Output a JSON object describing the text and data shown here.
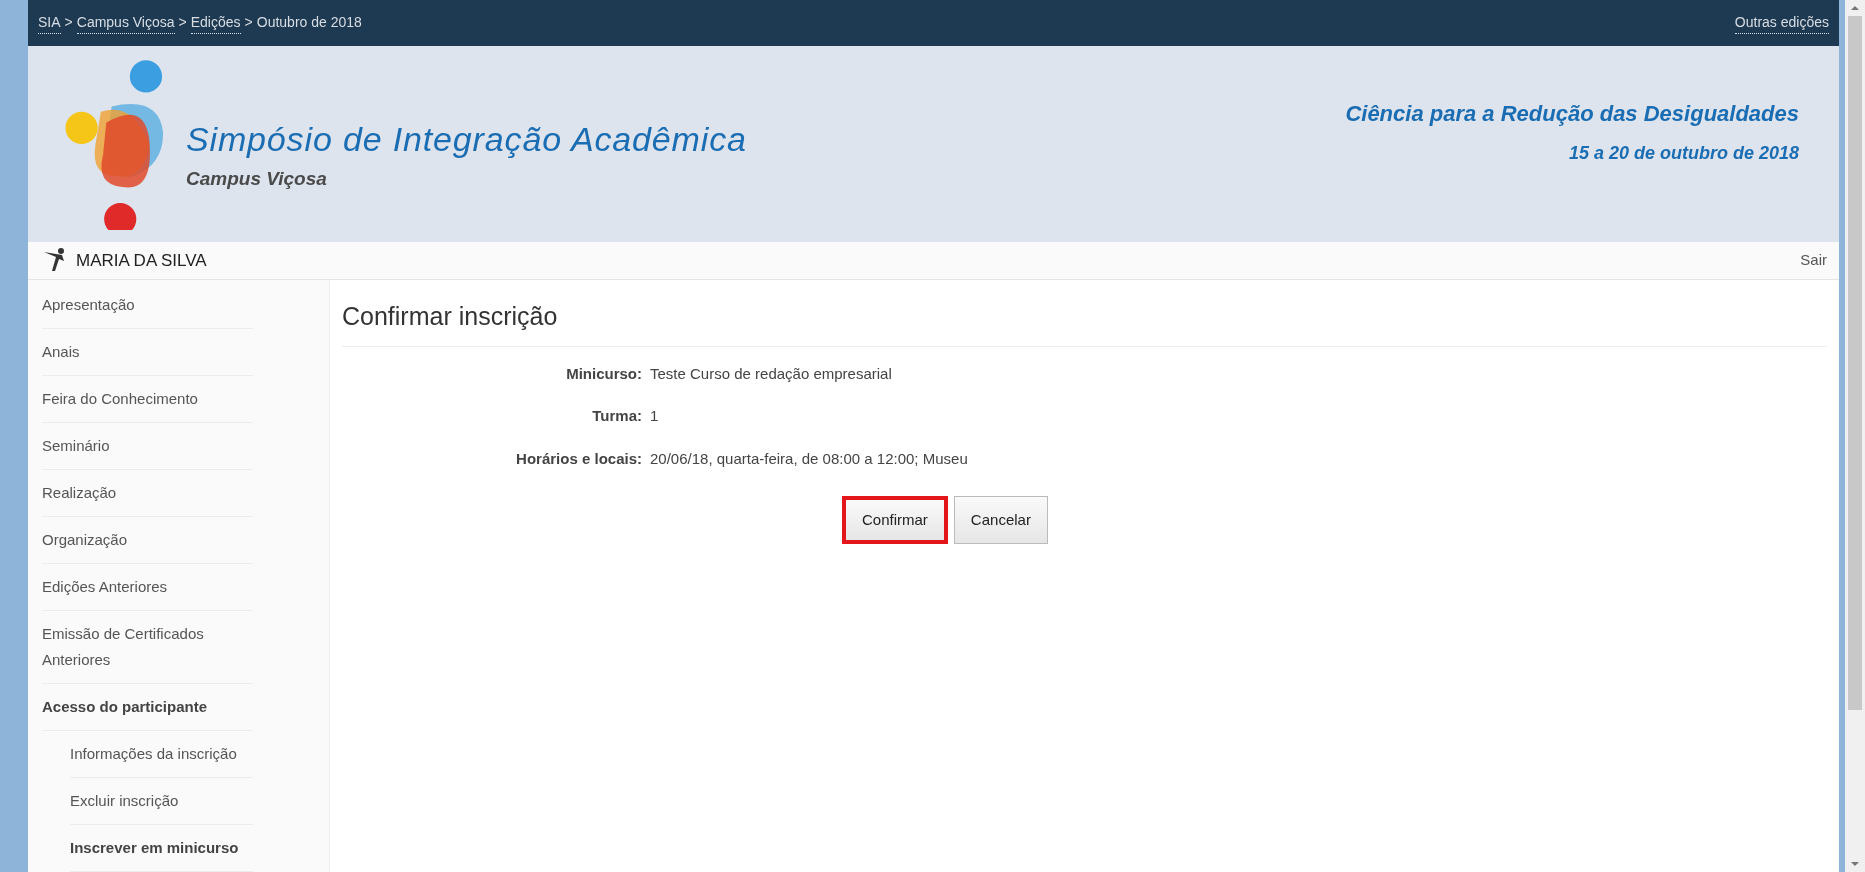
{
  "breadcrumb": [
    {
      "label": "SIA",
      "link": true
    },
    {
      "label": ">",
      "link": false
    },
    {
      "label": "Campus Viçosa",
      "link": true
    },
    {
      "label": ">",
      "link": false
    },
    {
      "label": "Edições",
      "link": true
    },
    {
      "label": ">",
      "link": false
    },
    {
      "label": "Outubro de 2018",
      "link": false
    }
  ],
  "top_link": "Outras edições",
  "header": {
    "title": "Simpósio de Integração Acadêmica",
    "subtitle": "Campus Viçosa",
    "theme": "Ciência para a Redução das Desigualdades",
    "dates": "15 a 20 de outubro de 2018"
  },
  "user": {
    "name": "MARIA DA SILVA",
    "logout": "Sair"
  },
  "sidebar": {
    "items": [
      {
        "label": "Apresentação",
        "kind": "link",
        "selected": false
      },
      {
        "label": "Anais",
        "kind": "link",
        "selected": false
      },
      {
        "label": "Feira do Conhecimento",
        "kind": "link",
        "selected": false
      },
      {
        "label": "Seminário",
        "kind": "link",
        "selected": false
      },
      {
        "label": "Realização",
        "kind": "link",
        "selected": false
      },
      {
        "label": "Organização",
        "kind": "link",
        "selected": false
      },
      {
        "label": "Edições Anteriores",
        "kind": "link",
        "selected": false
      },
      {
        "label": "Emissão de Certificados Anteriores",
        "kind": "link",
        "selected": false
      },
      {
        "label": "Acesso do participante",
        "kind": "section",
        "children": [
          {
            "label": "Informações da inscrição",
            "selected": false
          },
          {
            "label": "Excluir inscrição",
            "selected": false
          },
          {
            "label": "Inscrever em minicurso",
            "selected": true
          }
        ]
      }
    ]
  },
  "content": {
    "title": "Confirmar inscrição",
    "fields": [
      {
        "label": "Minicurso:",
        "value": "Teste Curso de redação empresarial"
      },
      {
        "label": "Turma:",
        "value": "1"
      },
      {
        "label": "Horários e locais:",
        "value": "20/06/18, quarta-feira, de 08:00 a 12:00; Museu"
      }
    ],
    "buttons": [
      {
        "label": "Confirmar",
        "highlighted": true
      },
      {
        "label": "Cancelar",
        "highlighted": false
      }
    ]
  }
}
